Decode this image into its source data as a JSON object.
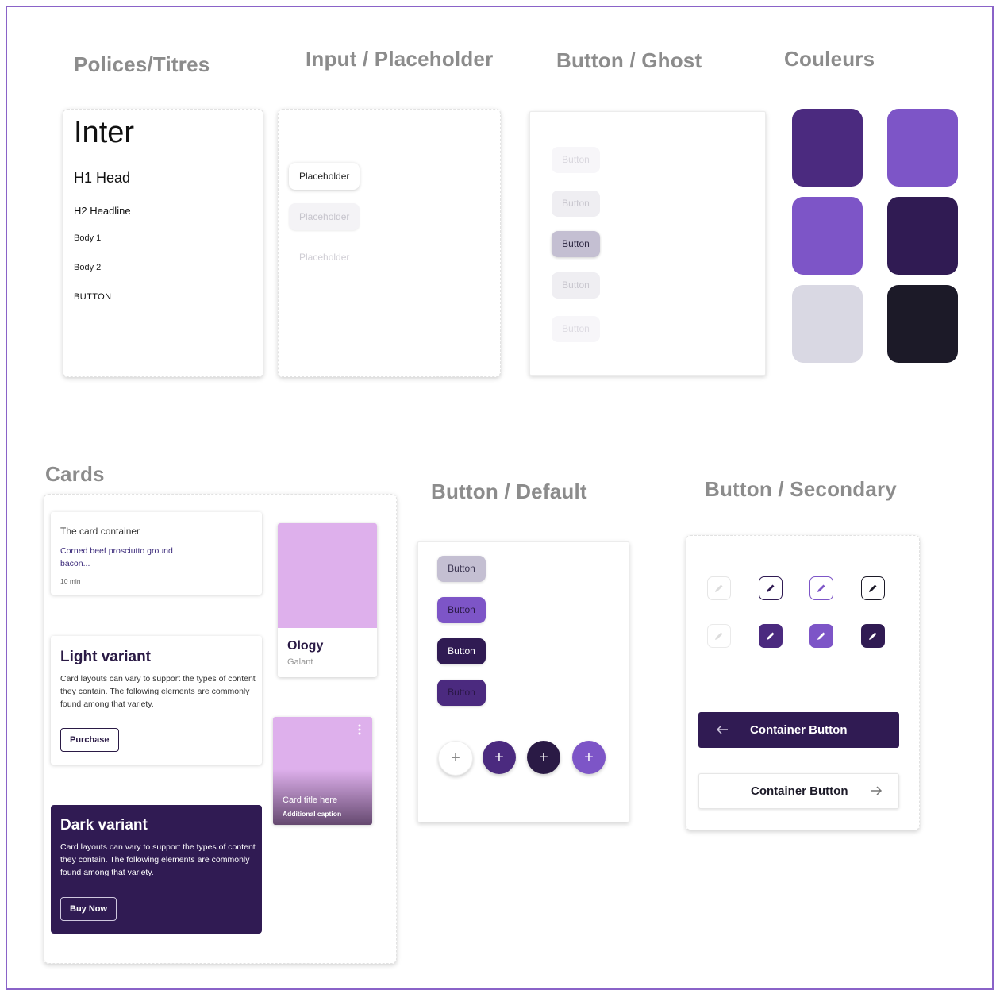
{
  "sections": {
    "typography": "Polices/Titres",
    "input": "Input / Placeholder",
    "ghost": "Button / Ghost",
    "colors": "Couleurs",
    "cards": "Cards",
    "default": "Button / Default",
    "secondary": "Button / Secondary"
  },
  "typography": {
    "font_name": "Inter",
    "h1": "H1 Head",
    "h2": "H2 Headline",
    "body1": "Body 1",
    "body2": "Body 2",
    "button": "BUTTON"
  },
  "inputs": [
    {
      "placeholder": "Placeholder",
      "state": "focused"
    },
    {
      "placeholder": "Placeholder",
      "state": "soft"
    },
    {
      "placeholder": "Placeholder",
      "state": "plain"
    }
  ],
  "ghost_buttons": [
    {
      "label": "Button",
      "bg": "#f7f6f9",
      "fg": "#d9d7de"
    },
    {
      "label": "Button",
      "bg": "#efeef2",
      "fg": "#c9c7cf"
    },
    {
      "label": "Button",
      "bg": "#c4bfd2",
      "fg": "#2f2a44"
    },
    {
      "label": "Button",
      "bg": "#efeef2",
      "fg": "#c9c7cf"
    },
    {
      "label": "Button",
      "bg": "#f7f6f9",
      "fg": "#dddbe2"
    }
  ],
  "colors": [
    "#4b2a7f",
    "#7d55c7",
    "#7d55c7",
    "#301b53",
    "#d9d8e3",
    "#1c1a28"
  ],
  "cards": {
    "container": {
      "title": "The card container",
      "subtitle": "Corned beef prosciutto ground bacon...",
      "time": "10 min"
    },
    "media": {
      "title": "Ology",
      "subtitle": "Galant",
      "image_color": "#deb0ec"
    },
    "light": {
      "title": "Light variant",
      "body": "Card layouts can vary to support the types of content they contain. The following elements are commonly found among that variety.",
      "button": "Purchase"
    },
    "overlay": {
      "title": "Card title here",
      "caption": "Additional caption",
      "menu_icon": "more-vertical-icon"
    },
    "dark": {
      "title": "Dark variant",
      "body": "Card layouts can vary to support the types of content they contain. The following elements are commonly found among that variety.",
      "button": "Buy Now"
    }
  },
  "default_buttons": [
    {
      "label": "Button",
      "bg": "#c4bfd2",
      "fg": "#3a3450"
    },
    {
      "label": "Button",
      "bg": "#7d55c7",
      "fg": "#2a1a45"
    },
    {
      "label": "Button",
      "bg": "#301b53",
      "fg": "#ffffff"
    },
    {
      "label": "Button",
      "bg": "#4b2a7f",
      "fg": "#2a1746"
    }
  ],
  "fabs": [
    {
      "icon": "plus-icon",
      "glyph": "+",
      "bg": "#ffffff",
      "fg": "#8a8a8a"
    },
    {
      "icon": "plus-icon",
      "glyph": "+",
      "bg": "#4b2a7f",
      "fg": "#ffffff"
    },
    {
      "icon": "plus-icon",
      "glyph": "+",
      "bg": "#2a1a45",
      "fg": "#ffffff"
    },
    {
      "icon": "plus-icon",
      "glyph": "+",
      "bg": "#7d55c7",
      "fg": "#ffffff"
    }
  ],
  "icon_buttons": {
    "icon": "pencil-icon",
    "outlined": [
      {
        "border": "#e6e6e6",
        "fg": "#dcdcdc"
      },
      {
        "border": "#301b53",
        "fg": "#301b53"
      },
      {
        "border": "#7d55c7",
        "fg": "#7d55c7"
      },
      {
        "border": "#1c1a28",
        "fg": "#1c1a28"
      }
    ],
    "filled": [
      {
        "bg": "#ffffff",
        "fg": "#dcdcdc"
      },
      {
        "bg": "#4b2a7f",
        "fg": "#ffffff"
      },
      {
        "bg": "#7d55c7",
        "fg": "#ffffff"
      },
      {
        "bg": "#301b53",
        "fg": "#ffffff"
      }
    ]
  },
  "container_buttons": [
    {
      "label": "Container Button",
      "icon": "arrow-left-icon",
      "style": "filled",
      "bg": "#301b53"
    },
    {
      "label": "Container Button",
      "icon": "arrow-right-icon",
      "style": "outlined"
    }
  ]
}
